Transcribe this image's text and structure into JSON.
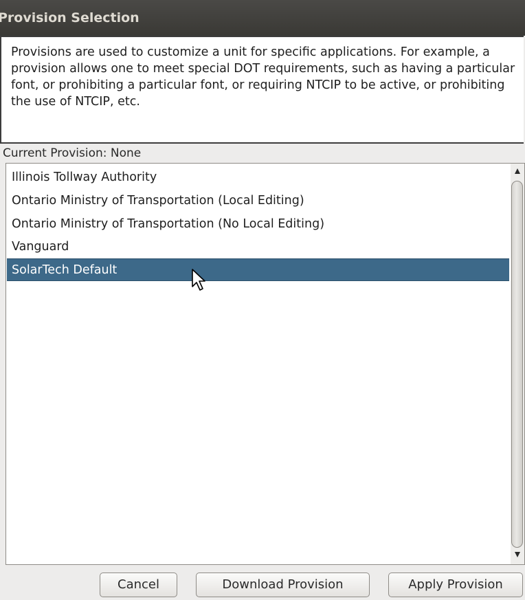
{
  "window": {
    "title": "Provision Selection"
  },
  "description": "Provisions are used to customize a unit for specific applications. For example, a provision allows one to meet special DOT requirements, such as having a particular font, or prohibiting a particular font, or requiring NTCIP to be active, or prohibiting the use of NTCIP, etc.",
  "current_provision": "Current Provision: None",
  "provisions": {
    "items": [
      {
        "label": "Illinois Tollway Authority",
        "selected": false
      },
      {
        "label": "Ontario Ministry of Transportation (Local Editing)",
        "selected": false
      },
      {
        "label": "Ontario Ministry of Transportation (No Local Editing)",
        "selected": false
      },
      {
        "label": "Vanguard",
        "selected": false
      },
      {
        "label": "SolarTech Default",
        "selected": true
      }
    ]
  },
  "scrollbar": {
    "up_icon": "arrow-up-icon",
    "down_icon": "arrow-down-icon"
  },
  "buttons": {
    "cancel": "Cancel",
    "download": "Download Provision",
    "apply": "Apply Provision"
  },
  "colors": {
    "titlebar": "#3f3e3a",
    "selection": "#3d6989"
  }
}
